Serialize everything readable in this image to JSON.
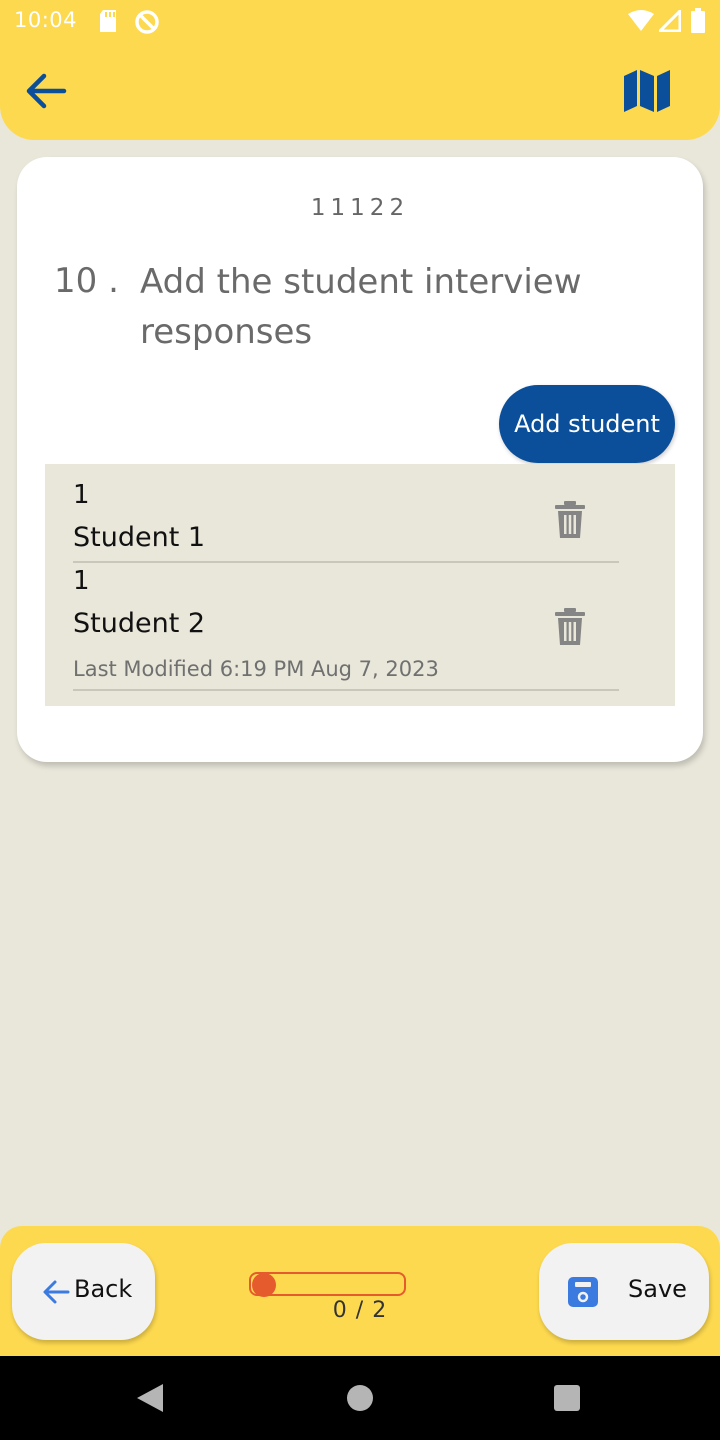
{
  "status_bar": {
    "time": "10:04",
    "icons": [
      "sd-card-icon",
      "do-not-disturb-icon",
      "wifi-icon",
      "signal-icon",
      "battery-icon"
    ]
  },
  "app_bar": {
    "back_icon": "arrow-left-icon",
    "map_icon": "map-icon"
  },
  "question": {
    "code": "11122",
    "number": "10 .",
    "text": "Add the student interview responses",
    "add_button_label": "Add student"
  },
  "students": [
    {
      "number": "1",
      "name": "Student 1",
      "last_modified": ""
    },
    {
      "number": "1",
      "name": "Student 2",
      "last_modified": "Last Modified 6:19 PM Aug 7, 2023"
    }
  ],
  "bottom_bar": {
    "back_label": "Back",
    "save_label": "Save",
    "progress_text": "0 / 2",
    "progress_value": 0
  },
  "colors": {
    "accent_yellow": "#fdd94f",
    "primary_blue": "#0b4f9a",
    "progress_orange": "#e55b2d",
    "background": "#e9e7da"
  }
}
